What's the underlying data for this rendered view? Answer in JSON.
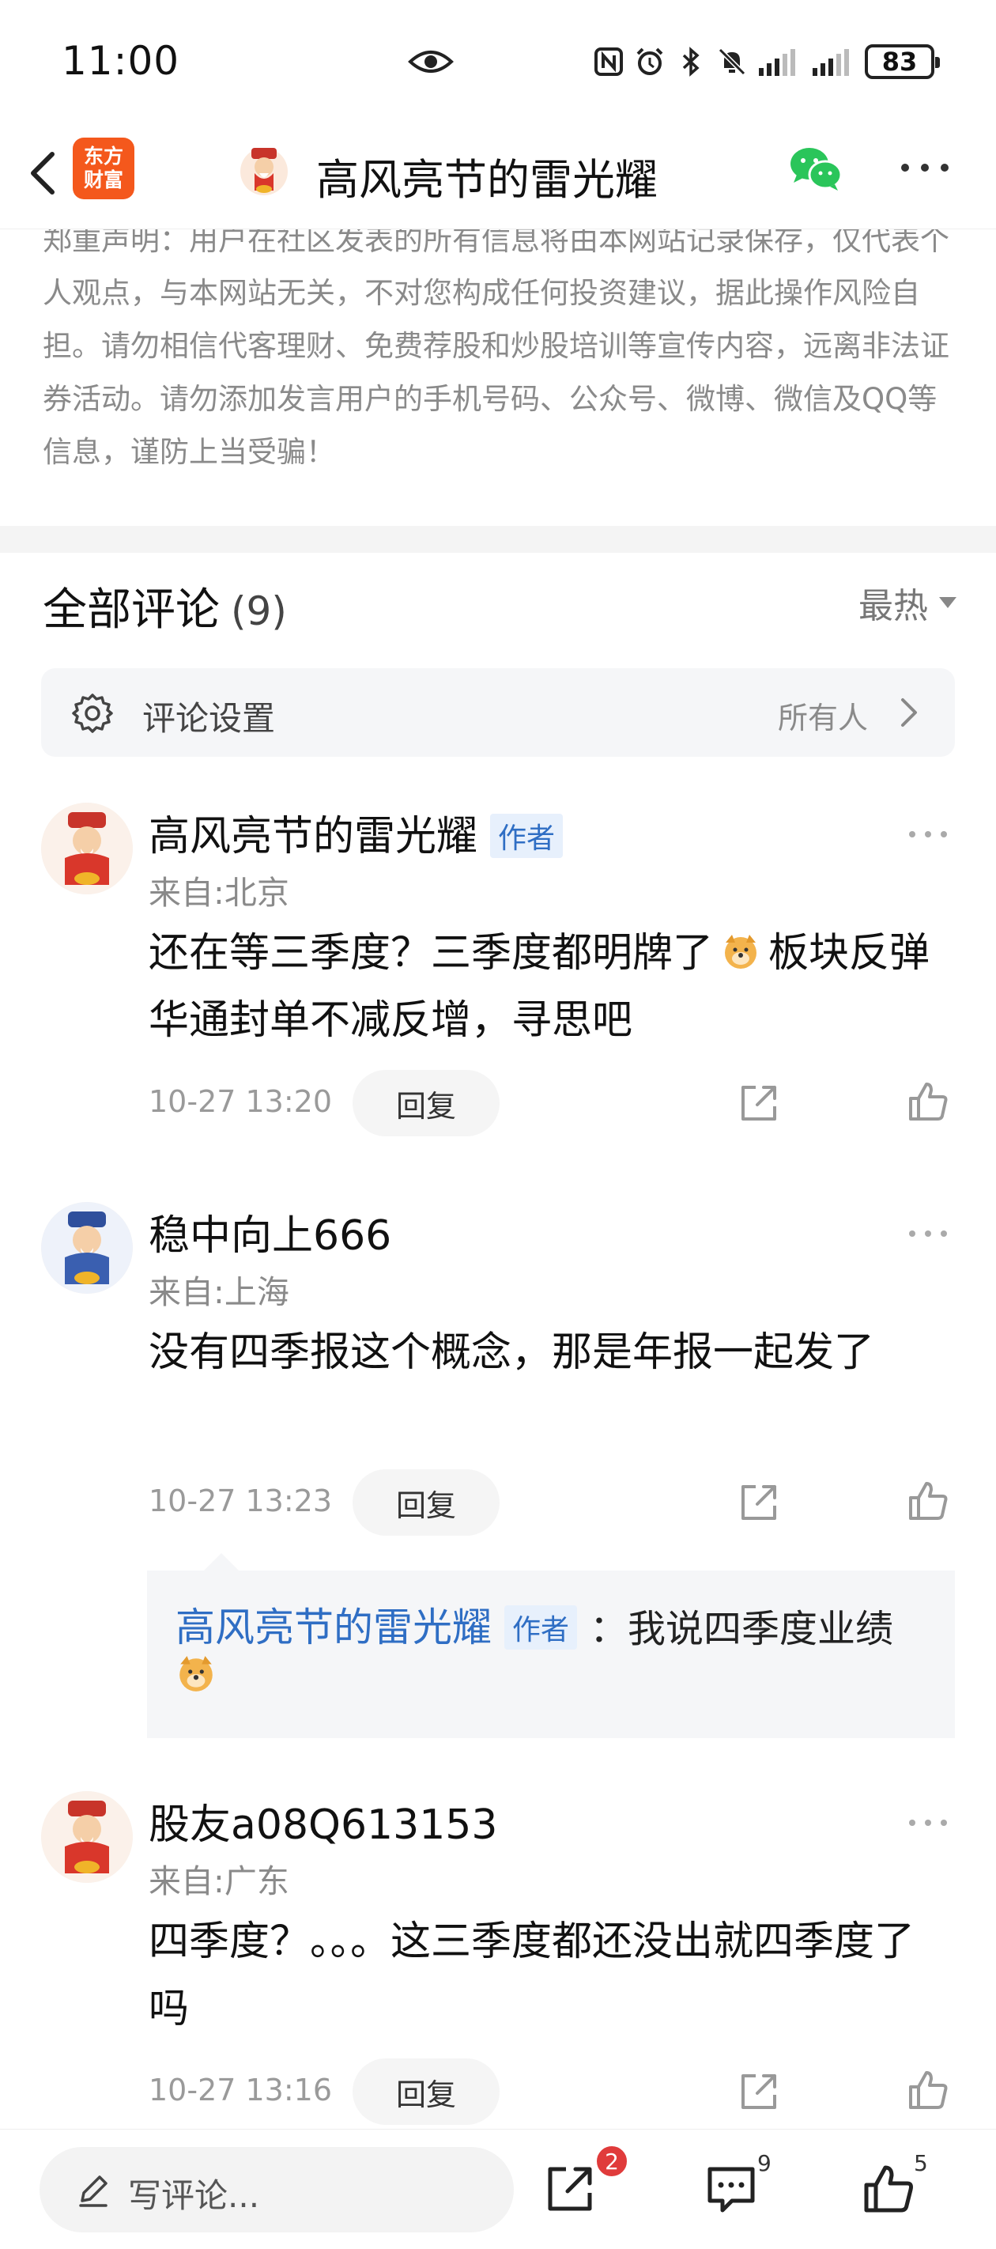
{
  "status": {
    "time": "11:00",
    "battery": "83"
  },
  "nav": {
    "app_logo_line1": "东方",
    "app_logo_line2": "财富",
    "title": "高风亮节的雷光耀"
  },
  "disclaimer": "郑重声明：用户在社区发表的所有信息将由本网站记录保存，仅代表个人观点，与本网站无关，不对您构成任何投资建议，据此操作风险自担。请勿相信代客理财、免费荐股和炒股培训等宣传内容，远离非法证券活动。请勿添加发言用户的手机号码、公众号、微博、微信及QQ等信息，谨防上当受骗！",
  "comments_header": {
    "title": "全部评论",
    "count": "(9)",
    "sort": "最热"
  },
  "settings": {
    "label": "评论设置",
    "value": "所有人"
  },
  "comments": [
    {
      "name": "高风亮节的雷光耀",
      "badge": "作者",
      "from": "来自:北京",
      "text_a": "还在等三季度？三季度都明牌了",
      "text_b": "板块反弹华通封单不减反增，寻思吧",
      "time": "10-27 13:20",
      "reply": "回复"
    },
    {
      "name": "稳中向上666",
      "from": "来自:上海",
      "text": "没有四季报这个概念，那是年报一起发了",
      "time": "10-27 13:23",
      "reply": "回复",
      "sub_reply": {
        "name": "高风亮节的雷光耀",
        "badge": "作者",
        "text": "：我说四季度业绩"
      }
    },
    {
      "name": "股友a08Q613153",
      "from": "来自:广东",
      "text": "四季度？。。。这三季度都还没出就四季度了吗",
      "time": "10-27 13:16",
      "reply": "回复"
    }
  ],
  "bottom": {
    "placeholder": "写评论...",
    "share_badge": "2",
    "comment_count": "9",
    "like_count": "5"
  },
  "icons": [
    "eye-icon",
    "nfc-icon",
    "alarm-icon",
    "bluetooth-icon",
    "mute-icon",
    "signal-icon",
    "back-arrow-icon",
    "wechat-icon",
    "more-icon",
    "gear-icon",
    "chevron-right-icon",
    "share-icon",
    "like-icon",
    "doge-emoji-icon",
    "pen-icon",
    "comment-icon"
  ],
  "colors": {
    "brand": "#f4581c",
    "link": "#2f6ec4",
    "badge_red": "#e03b3b"
  }
}
